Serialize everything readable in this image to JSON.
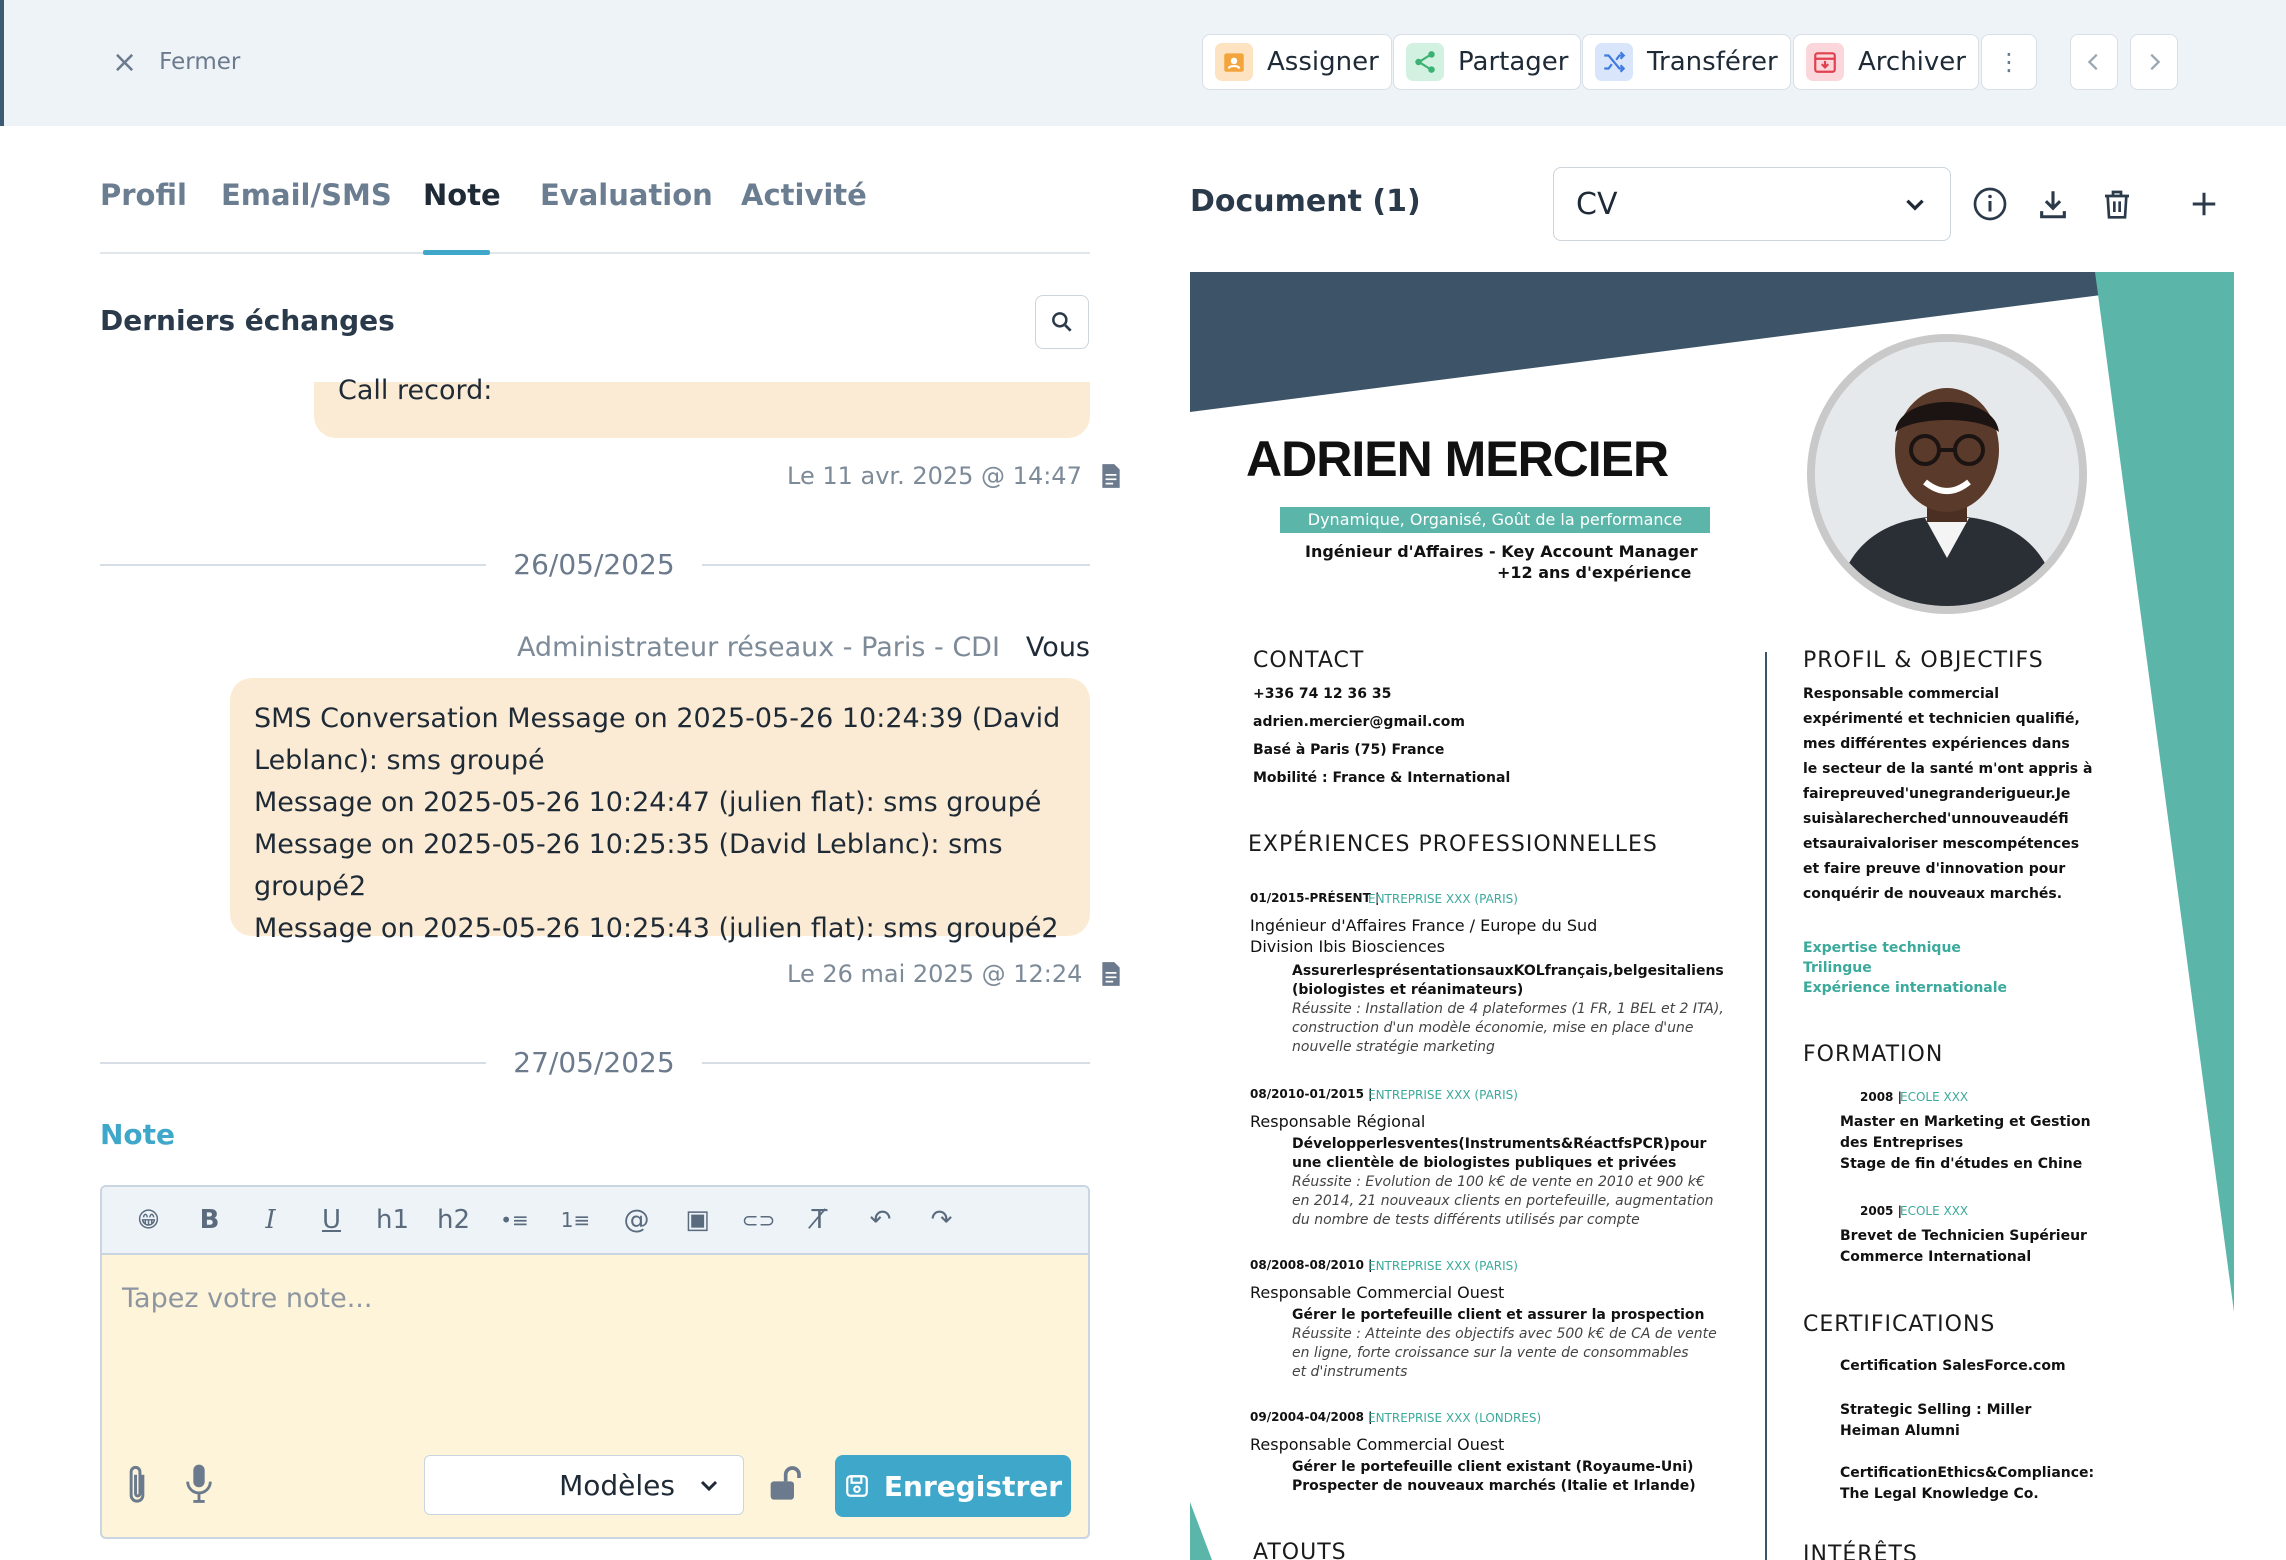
{
  "header": {
    "close_label": "Fermer",
    "actions": [
      {
        "label": "Assigner",
        "icon": "assign-icon",
        "color": "#f3a43b"
      },
      {
        "label": "Partager",
        "icon": "share-icon",
        "color": "#3bb273"
      },
      {
        "label": "Transférer",
        "icon": "transfer-icon",
        "color": "#3f7be0"
      },
      {
        "label": "Archiver",
        "icon": "archive-icon",
        "color": "#e0404f"
      }
    ]
  },
  "tabs": [
    {
      "label": "Profil"
    },
    {
      "label": "Email/SMS"
    },
    {
      "label": "Note",
      "active": true
    },
    {
      "label": "Evaluation"
    },
    {
      "label": "Activité"
    }
  ],
  "exchanges": {
    "title": "Derniers échanges",
    "partial_message": "Call record:",
    "partial_stamp": "Le 11 avr. 2025 @ 14:47",
    "date1": "26/05/2025",
    "sender_job": "Administrateur réseaux - Paris - CDI",
    "sender_you": "Vous",
    "message_lines": [
      "SMS Conversation Message on 2025-05-26 10:24:39 (David",
      "Leblanc): sms groupé",
      "Message on 2025-05-26 10:24:47 (julien flat): sms groupé",
      "Message on 2025-05-26 10:25:35 (David Leblanc): sms groupé2",
      "Message on 2025-05-26 10:25:43 (julien flat): sms groupé2"
    ],
    "message_stamp": "Le 26 mai 2025 @ 12:24",
    "date2": "27/05/2025"
  },
  "note": {
    "label": "Note",
    "placeholder": "Tapez votre note...",
    "models_label": "Modèles",
    "save_label": "Enregistrer",
    "toolbar": [
      "😁",
      "B",
      "I",
      "U",
      "h1",
      "h2",
      "•≡",
      "1≡",
      "@",
      "▣",
      "⊂⊃",
      "T̸",
      "↶",
      "↷"
    ]
  },
  "documents": {
    "title": "Document (1)",
    "selected": "CV"
  },
  "cv": {
    "name": "ADRIEN MERCIER",
    "tagline": "Dynamique, Organisé, Goût de la performance",
    "role": "Ingénieur d'Affaires - Key Account Manager",
    "experience": "+12 ans d'expérience",
    "contact_title": "CONTACT",
    "contact": [
      "+336 74 12 36 35",
      "adrien.mercier@gmail.com",
      "Basé à Paris (75) France",
      "Mobilité : France & International"
    ],
    "exp_title": "EXPÉRIENCES PROFESSIONNELLES",
    "jobs": [
      {
        "dates": "01/2015-PRÉSENT |",
        "company": "ENTREPRISE XXX (PARIS)",
        "title": "Ingénieur d'Affaires France / Europe du Sud",
        "sub": "Division Ibis Biosciences",
        "task": "AssurerlesprésentationsauxKOLfrançais,belgesitaliens",
        "task2": "(biologistes et réanimateurs)",
        "success_label": "Réussite :",
        "success": [
          " Installation de 4 plateformes (1 FR, 1 BEL et 2 ITA),",
          "construction d'un modèle économie, mise en place d'une",
          "nouvelle  stratégie marketing"
        ]
      },
      {
        "dates": "08/2010-01/2015 |",
        "company": "ENTREPRISE XXX (PARIS)",
        "title": "Responsable Régional",
        "sub": "",
        "task": "Développerlesventes(Instruments&RéactfsPCR)pour",
        "task2": "une  clientèle de biologistes publiques et privées",
        "success_label": "Réussite :",
        "success": [
          " Evolution de 100 k€ de vente en 2010 et 900 k€",
          "en 2014, 21 nouveaux clients en portefeuille, augmentation",
          "du nombre de tests différents utilisés par compte"
        ]
      },
      {
        "dates": "08/2008-08/2010 |",
        "company": "ENTREPRISE XXX (PARIS)",
        "title": "Responsable Commercial Ouest",
        "sub": "",
        "task": "Gérer le portefeuille client et assurer la prospection",
        "task2": "",
        "success_label": "Réussite :",
        "success": [
          " Atteinte des objectifs avec 500 k€ de CA de vente",
          "en ligne, forte croissance sur la vente de consommables",
          "et d'instruments"
        ]
      },
      {
        "dates": "09/2004-04/2008 |",
        "company": "ENTREPRISE XXX (LONDRES)",
        "title": "Responsable Commercial Ouest",
        "sub": "",
        "task": "Gérer le portefeuille client existant (Royaume-Uni)",
        "task2": "Prospecter de nouveaux marchés (Italie et Irlande)",
        "success_label": "",
        "success": []
      }
    ],
    "atouts_title": "ATOUTS",
    "profile_title": "PROFIL & OBJECTIFS",
    "profile_lines": [
      "Responsable commercial",
      "expérimenté et technicien qualifié,",
      "mes différentes expériences dans",
      "le secteur de la santé m'ont appris à",
      "fairepreuved'unegranderigueur.Je",
      "suisàlarecherched'unnouveaudéfi",
      "etsauraivaloriser mescompétences",
      "et faire preuve d'innovation pour",
      "conquérir de nouveaux marchés."
    ],
    "strengths": [
      "Expertise technique",
      "Trilingue",
      "Expérience  internationale"
    ],
    "formation_title": "FORMATION",
    "formation": [
      {
        "year": "2008 |",
        "school": "ECOLE XXX",
        "lines": [
          "Master en Marketing et  Gestion",
          "des Entreprises",
          "Stage de fin d'études en Chine"
        ]
      },
      {
        "year": "2005 |",
        "school": "ECOLE XXX",
        "lines": [
          "Brevet de Technicien Supérieur",
          "Commerce International"
        ]
      }
    ],
    "cert_title": "CERTIFICATIONS",
    "certs": [
      [
        "Certification SalesForce.com"
      ],
      [
        "Strategic Selling : Miller",
        "Heiman Alumni"
      ],
      [
        "CertificationEthics&Compliance:",
        "The Legal  Knowledge Co."
      ]
    ],
    "interests_title": "INTÉRÊTS",
    "colors": {
      "dark": "#3d5468",
      "teal": "#5bb5a8"
    }
  }
}
